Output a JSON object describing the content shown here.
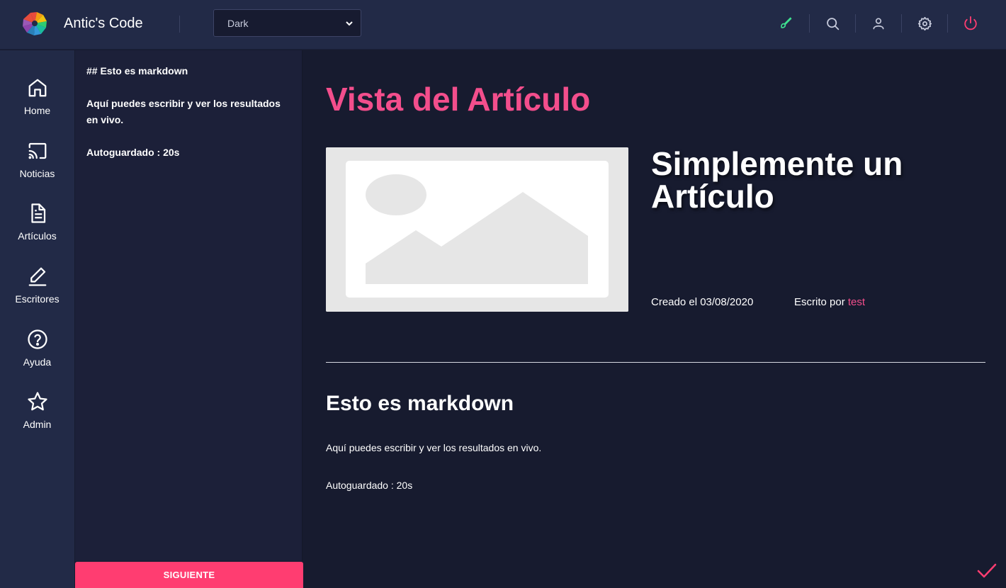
{
  "app": {
    "title": "Antic's Code",
    "logo_icon": "multicolor-pinwheel-logo"
  },
  "header": {
    "theme_select": {
      "value": "Dark",
      "options": [
        "Dark"
      ]
    },
    "icons": [
      "brush-icon",
      "search-icon",
      "user-icon",
      "gear-icon",
      "power-icon"
    ],
    "colors": {
      "brush": "#3ee08f",
      "power": "#ff3d71",
      "default": "#c7cbdc"
    }
  },
  "sidebar": {
    "items": [
      {
        "label": "Home",
        "icon": "home-icon"
      },
      {
        "label": "Noticias",
        "icon": "cast-icon"
      },
      {
        "label": "Artículos",
        "icon": "file-text-icon"
      },
      {
        "label": "Escritores",
        "icon": "edit-pen-icon"
      },
      {
        "label": "Ayuda",
        "icon": "help-circle-icon"
      },
      {
        "label": "Admin",
        "icon": "star-icon"
      }
    ]
  },
  "editor": {
    "lines": [
      "## Esto es markdown",
      "Aquí puedes escribir y ver los resultados en vivo.",
      "Autoguardado : 20s"
    ],
    "next_button": "SIGUIENTE"
  },
  "preview": {
    "heading": "Vista del Artículo",
    "article_title": "Simplemente un Artículo",
    "created_label": "Creado el 03/08/2020",
    "written_by_label": "Escrito por",
    "author": "test",
    "content": {
      "h2": "Esto es markdown",
      "paragraph1": "Aquí puedes escribir y ver los resultados en vivo.",
      "paragraph2": "Autoguardado : 20s"
    }
  },
  "accent_colors": {
    "pink": "#f34e8c",
    "button": "#ff3d71",
    "check": "#ff3d71"
  }
}
